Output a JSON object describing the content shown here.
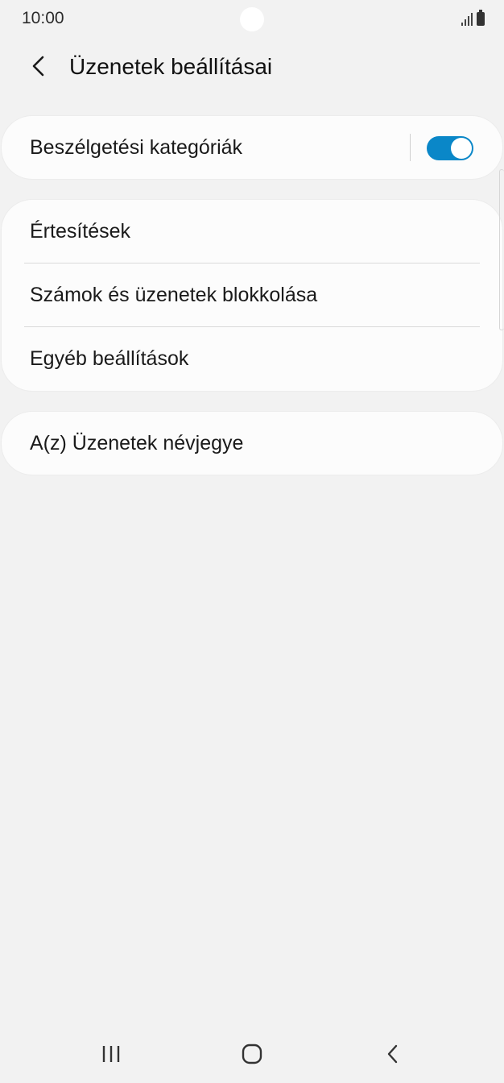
{
  "status_bar": {
    "time": "10:00",
    "icons": [
      "signal-icon",
      "battery-icon"
    ]
  },
  "header": {
    "back_icon": "chevron-left-icon",
    "title": "Üzenetek beállításai"
  },
  "settings": {
    "conversation_categories": {
      "label": "Beszélgetési kategóriák",
      "toggle_on": true,
      "toggle_color": "#0a87c8"
    },
    "group": {
      "items": [
        {
          "label": "Értesítések"
        },
        {
          "label": "Számok és üzenetek blokkolása"
        },
        {
          "label": "Egyéb beállítások"
        }
      ]
    },
    "about": {
      "label": "A(z) Üzenetek névjegye"
    }
  },
  "nav_bar": {
    "buttons": [
      "recent-apps-icon",
      "home-icon",
      "back-icon"
    ]
  },
  "colors": {
    "background": "#f2f2f2",
    "card": "#fcfcfc",
    "accent": "#0a87c8"
  }
}
